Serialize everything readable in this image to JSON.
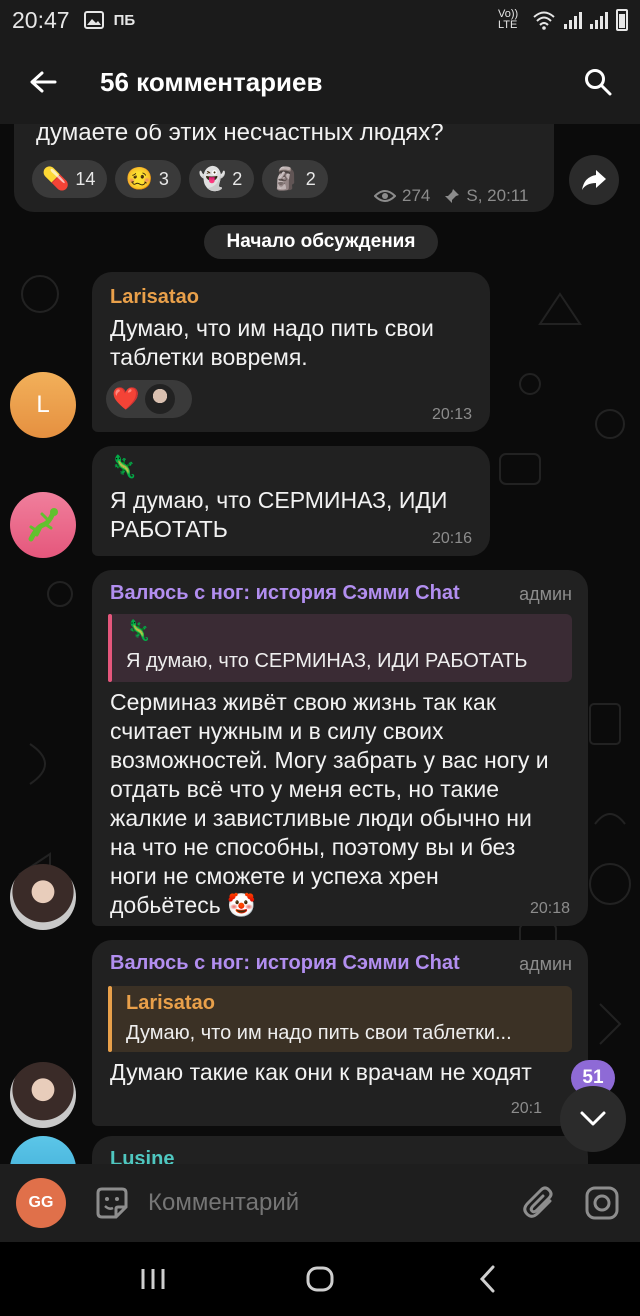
{
  "statusbar": {
    "time": "20:47",
    "carrier": "ПБ",
    "volte": "Vo)) LTE"
  },
  "header": {
    "title": "56 комментариев"
  },
  "post": {
    "text": "думаете об этих несчастных людях?",
    "reactions": [
      {
        "emoji": "💊",
        "count": "14"
      },
      {
        "emoji": "🥴",
        "count": "3"
      },
      {
        "emoji": "👻",
        "count": "2"
      },
      {
        "emoji": "🗿",
        "count": "2"
      }
    ],
    "views": "274",
    "meta": "S, 20:11"
  },
  "divider": {
    "label": "Начало обсуждения"
  },
  "messages": [
    {
      "author": "Larisatao",
      "author_color": "#e9a04a",
      "avatar_letter": "L",
      "text": "Думаю, что им надо пить свои таблетки вовремя.",
      "reaction_emoji": "❤️",
      "time": "20:13"
    },
    {
      "sticker": "🦎",
      "text": "Я думаю, что СЕРМИНАЗ, ИДИ РАБОТАТЬ",
      "time": "20:16"
    },
    {
      "author": "Валюсь с ног: история Сэмми Chat",
      "author_color": "#b28ef0",
      "role": "админ",
      "quote_sticker": "🦎",
      "quote_text": "Я думаю, что СЕРМИНАЗ, ИДИ РАБОТАТЬ",
      "text": "Серминаз живёт свою жизнь так как считает нужным и в силу своих возможностей. Могу забрать у вас ногу и отдать всё что у меня есть, но такие жалкие и завистливые люди обычно ни на что не способны, поэтому вы и без ноги не сможете и успеха хрен добьётесь 🤡",
      "time": "20:18"
    },
    {
      "author": "Валюсь с ног: история Сэмми Chat",
      "author_color": "#b28ef0",
      "role": "админ",
      "quote_author": "Larisatao",
      "quote_text": "Думаю, что им надо пить свои таблетки...",
      "text": "Думаю такие как они к врачам не ходят",
      "time": "20:1"
    },
    {
      "author": "Lusine",
      "author_color": "#4fc7c0"
    }
  ],
  "scroll": {
    "unread": "51"
  },
  "input": {
    "avatar_initials": "GG",
    "placeholder": "Комментарий"
  }
}
